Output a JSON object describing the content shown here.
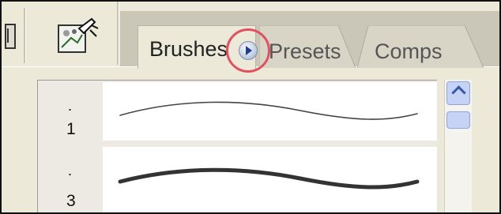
{
  "tabs": [
    {
      "label": "Brushes",
      "active": true
    },
    {
      "label": "Presets",
      "active": false
    },
    {
      "label": "Comps",
      "active": false
    }
  ],
  "brush_list": [
    {
      "dot": ".",
      "size": "1"
    },
    {
      "dot": ".",
      "size": "3"
    }
  ],
  "colors": {
    "highlight_ring": "#e05060",
    "menu_button": "#1f3d8c",
    "panel_bg": "#ece9d8"
  },
  "icons": {
    "toolbar_tool": "tool-brush-icon",
    "panel_menu": "play-triangle-icon",
    "scroll_up": "chevron-up-icon"
  }
}
